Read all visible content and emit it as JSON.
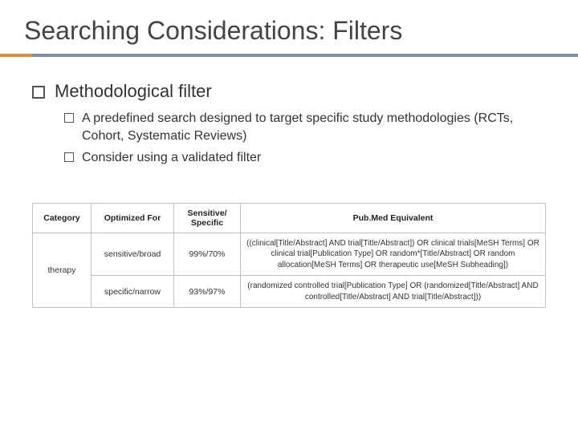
{
  "title": "Searching Considerations: Filters",
  "bullets": {
    "l1": "Methodological filter",
    "l2a": "A predefined search designed to target specific study methodologies (RCTs, Cohort, Systematic Reviews)",
    "l2b": "Consider using a validated filter"
  },
  "table": {
    "headers": {
      "h1": "Category",
      "h2": "Optimized For",
      "h3": "Sensitive/ Specific",
      "h4": "Pub.Med Equivalent"
    },
    "rows": [
      {
        "category": "therapy",
        "opt": "sensitive/broad",
        "ss": "99%/70%",
        "eq": "((clinical[Title/Abstract] AND trial[Title/Abstract]) OR clinical trials[MeSH Terms] OR clinical trial[Publication Type] OR random*[Title/Abstract] OR random allocation[MeSH Terms] OR therapeutic use[MeSH Subheading])"
      },
      {
        "category": "",
        "opt": "specific/narrow",
        "ss": "93%/97%",
        "eq": "(randomized controlled trial[Publication Type] OR (randomized[Title/Abstract] AND controlled[Title/Abstract] AND trial[Title/Abstract]))"
      }
    ]
  }
}
